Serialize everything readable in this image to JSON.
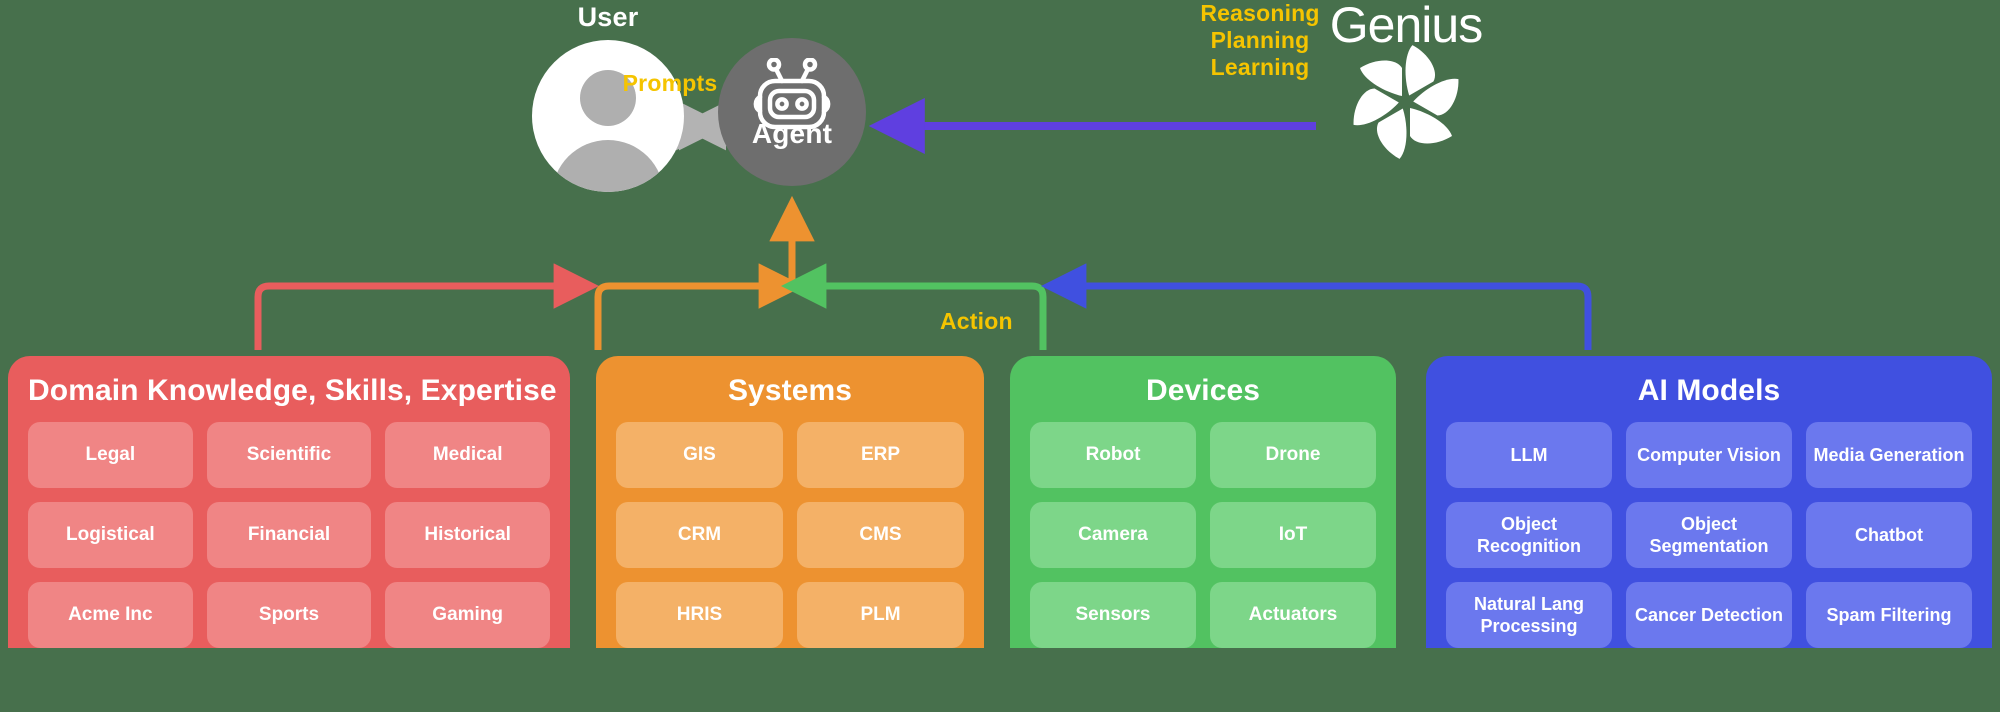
{
  "background_color": "#47704c",
  "top": {
    "user": {
      "label": "User",
      "icon": "user-avatar-icon"
    },
    "agent": {
      "label": "Agent",
      "icon": "robot-icon",
      "circle_color": "#6e6e6e"
    },
    "brand": {
      "name": "Genius",
      "icon": "genius-flower-logo-icon"
    },
    "flows": {
      "prompts": "Prompts",
      "reasoning_planning_learning": "Reasoning\nPlanning\nLearning",
      "reasoning_lines": [
        "Reasoning",
        "Planning",
        "Learning"
      ],
      "action": "Action",
      "label_color": "#f5c400",
      "prompts_arrow_color": "#b3b3b3",
      "brand_arrow_color": "#5f3fe0"
    }
  },
  "panels": [
    {
      "id": "domain",
      "title": "Domain Knowledge, Skills, Expertise",
      "color": "#e85d5d",
      "chip_color": "#f08585",
      "arrow_color": "#e85d5d",
      "items": [
        "Legal",
        "Scientific",
        "Medical",
        "Logistical",
        "Financial",
        "Historical",
        "Acme Inc",
        "Sports",
        "Gaming"
      ]
    },
    {
      "id": "systems",
      "title": "Systems",
      "color": "#ed9230",
      "chip_color": "#f4b167",
      "arrow_color": "#ed9230",
      "items": [
        "GIS",
        "ERP",
        "CRM",
        "CMS",
        "HRIS",
        "PLM"
      ]
    },
    {
      "id": "devices",
      "title": "Devices",
      "color": "#52c261",
      "chip_color": "#7dd689",
      "arrow_color": "#52c261",
      "items": [
        "Robot",
        "Drone",
        "Camera",
        "IoT",
        "Sensors",
        "Actuators"
      ]
    },
    {
      "id": "models",
      "title": "AI Models",
      "color": "#4050e0",
      "chip_color": "#6b78ee",
      "arrow_color": "#4050e0",
      "items": [
        "LLM",
        "Computer Vision",
        "Media Generation",
        "Object Recognition",
        "Object Segmentation",
        "Chatbot",
        "Natural Lang Processing",
        "Cancer Detection",
        "Spam Filtering"
      ]
    }
  ]
}
